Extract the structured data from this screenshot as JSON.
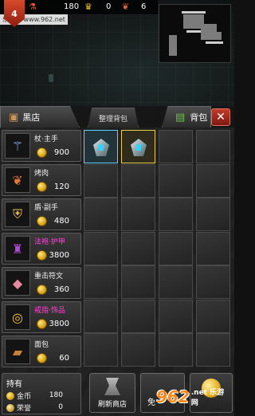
{
  "hud": {
    "level": "4",
    "gold": "180",
    "crowns": "0",
    "meat": "6"
  },
  "watermark": "乐游网 www.962.net",
  "tabs": {
    "shop_label": "黑店",
    "sort_label": "整理背包",
    "bag_label": "背包",
    "close_label": "✕"
  },
  "shop": {
    "items": [
      {
        "name": "杖·主手",
        "price": "900",
        "icon": "staff-icon",
        "highlight": false
      },
      {
        "name": "烤肉",
        "price": "120",
        "icon": "meat-icon",
        "highlight": false
      },
      {
        "name": "盾·副手",
        "price": "480",
        "icon": "shield-icon",
        "highlight": false
      },
      {
        "name": "法袍·护甲",
        "price": "3800",
        "icon": "robe-icon",
        "highlight": true
      },
      {
        "name": "重击符文",
        "price": "360",
        "icon": "rune-icon",
        "highlight": false
      },
      {
        "name": "戒指·饰品",
        "price": "3800",
        "icon": "ring-icon",
        "highlight": true
      },
      {
        "name": "面包",
        "price": "60",
        "icon": "bread-icon",
        "highlight": false
      }
    ]
  },
  "inventory": {
    "rows": 7,
    "cols": 4,
    "filled": [
      {
        "slot": 0,
        "item": "gem-icon",
        "frame": "blue"
      },
      {
        "slot": 1,
        "item": "gem-icon",
        "frame": "gold"
      }
    ]
  },
  "holdings": {
    "title": "持有",
    "gold_label": "金币",
    "gold_value": "180",
    "honor_label": "荣誉",
    "honor_value": "0"
  },
  "buttons": {
    "refresh_label": "刷新商店",
    "free_label": "免"
  },
  "logo": {
    "main": "962",
    "sub": ".net 乐游网"
  },
  "colors": {
    "magenta_text": "#ff46d6",
    "accent_red": "#c23b2a",
    "coin_gold": "#d9a416",
    "select_blue": "#5fd6ff",
    "select_gold": "#e9cd4c"
  }
}
